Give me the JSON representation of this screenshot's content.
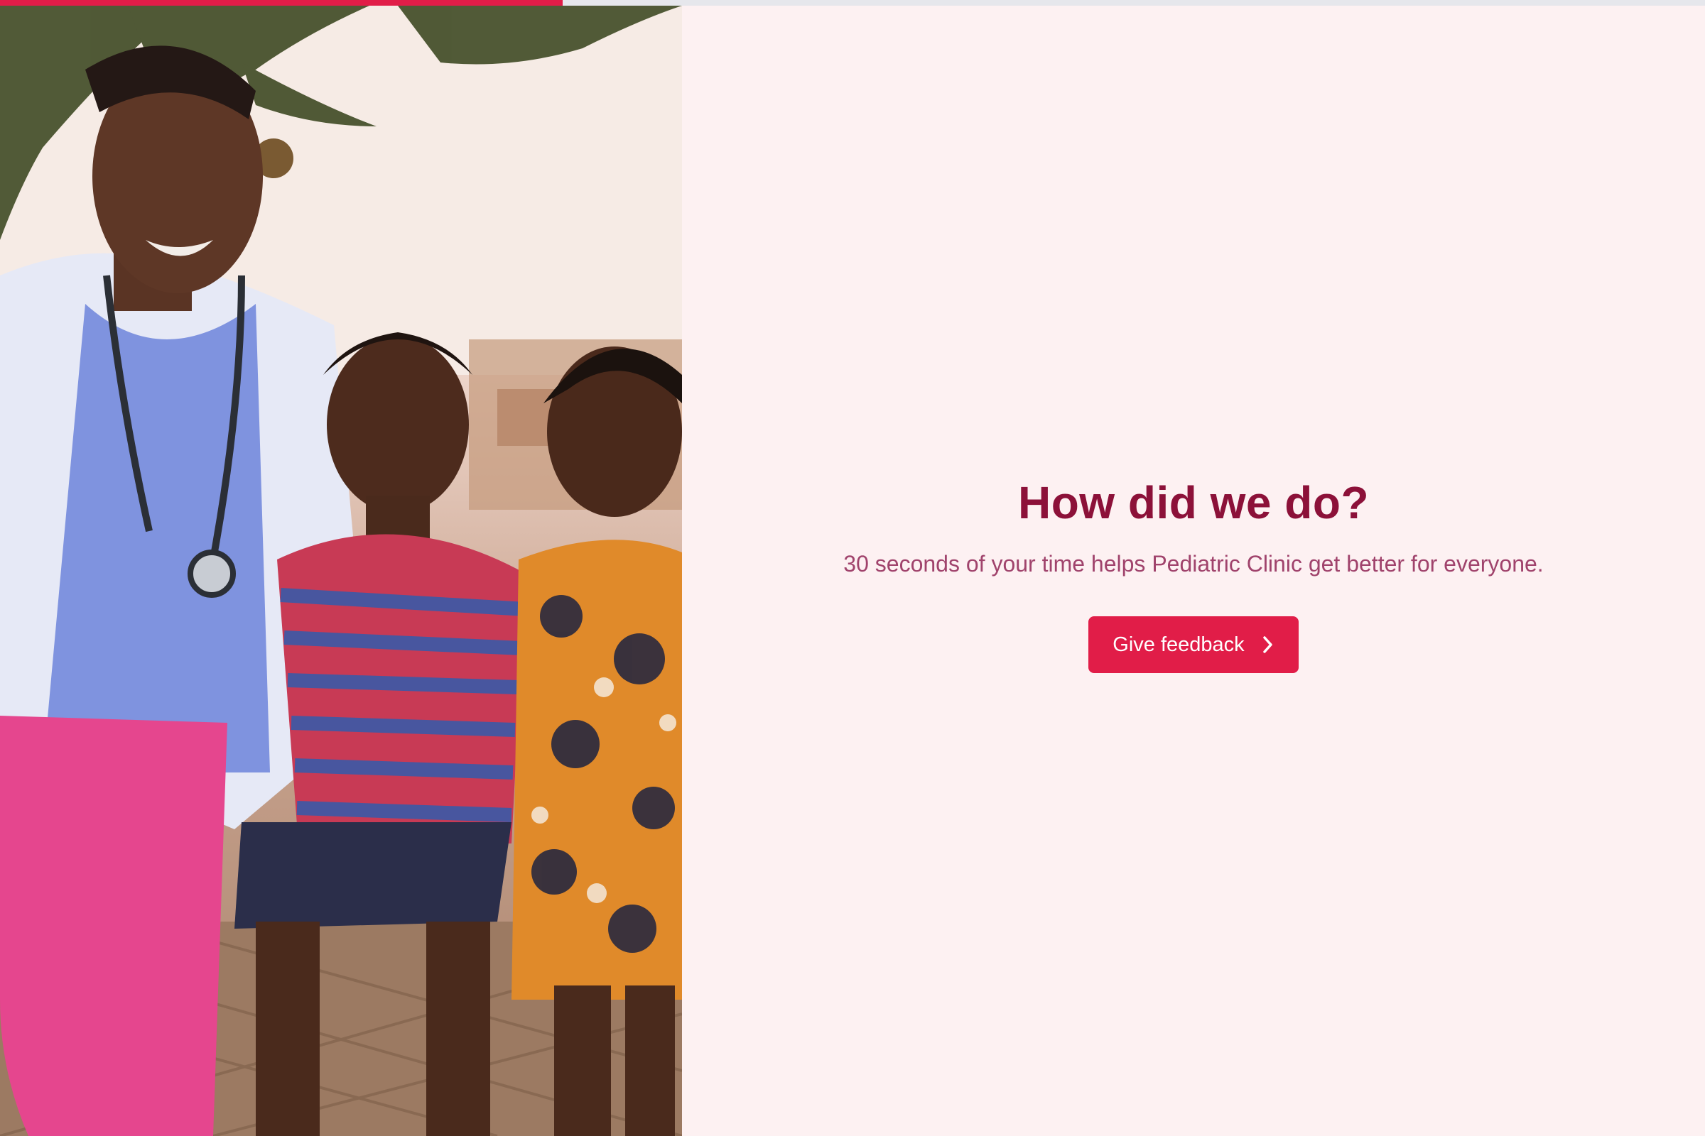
{
  "progress": {
    "value": 0.33,
    "color": "#e11d48",
    "track_color": "#e6e7ec"
  },
  "hero": {
    "title": "How did we do?",
    "subtitle": "30 seconds of your time helps Pediatric Clinic get better for everyone.",
    "cta_label": "Give feedback",
    "cta_icon": "chevron-right-icon"
  },
  "photo": {
    "subject": "clinic-photo"
  },
  "colors": {
    "accent": "#e11d48",
    "title": "#8c1139",
    "subtitle": "#a0436c",
    "background": "#fdf1f2"
  }
}
